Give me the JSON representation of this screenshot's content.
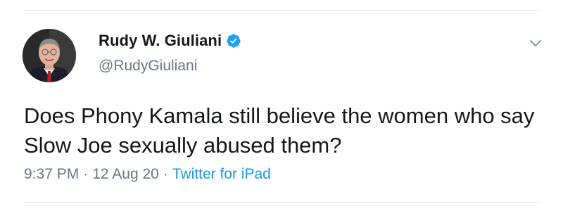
{
  "tweet": {
    "author": {
      "display_name": "Rudy W. Giuliani",
      "handle": "@RudyGiuliani",
      "verified": true
    },
    "text": "Does Phony Kamala still believe the women who say Slow Joe sexually abused them?",
    "time": "9:37 PM",
    "separator": "·",
    "date": "12 Aug 20",
    "source": "Twitter for iPad"
  },
  "colors": {
    "text_primary": "#14171a",
    "text_secondary": "#657786",
    "accent": "#1b95e0",
    "verified_badge": "#1da1f2",
    "divider": "#e1e8ed"
  },
  "icons": {
    "verified": "verified-badge-icon",
    "more": "chevron-down-icon"
  }
}
